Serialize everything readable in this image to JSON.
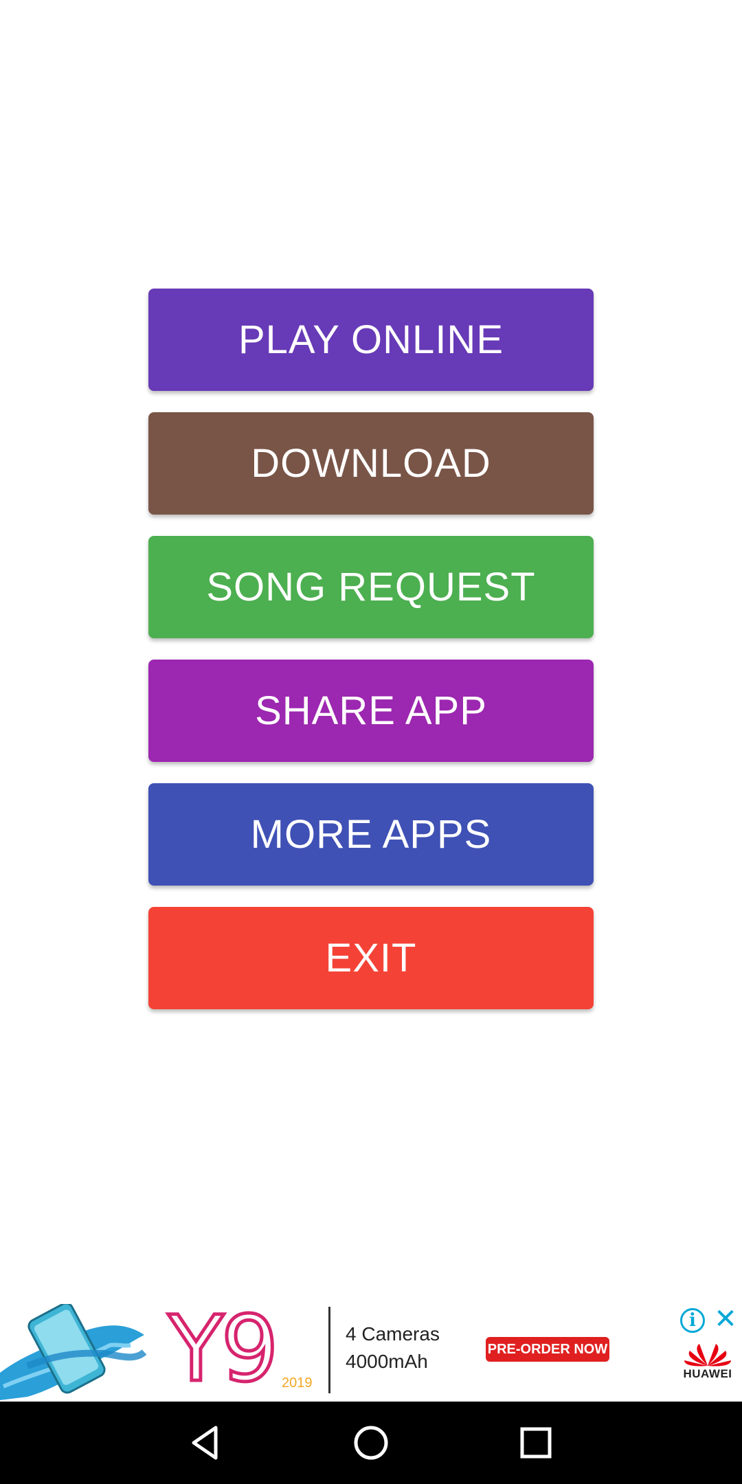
{
  "menu": {
    "buttons": [
      {
        "id": "play_online",
        "label": "PLAY ONLINE",
        "color": "#673ab7"
      },
      {
        "id": "download",
        "label": "DOWNLOAD",
        "color": "#795548"
      },
      {
        "id": "song_request",
        "label": "SONG REQUEST",
        "color": "#4caf50"
      },
      {
        "id": "share_app",
        "label": "SHARE APP",
        "color": "#9c27b0"
      },
      {
        "id": "more_apps",
        "label": "MORE APPS",
        "color": "#3f51b5"
      },
      {
        "id": "exit",
        "label": "EXIT",
        "color": "#f44336"
      }
    ]
  },
  "ad": {
    "product": "Y9",
    "year": "2019",
    "spec_line1": "4 Cameras",
    "spec_line2": "4000mAh",
    "cta": "PRE-ORDER NOW",
    "brand": "HUAWEI",
    "info_icon": "info-icon",
    "close_icon": "close-icon",
    "accent": "#00a8d6"
  },
  "nav_bar": {
    "back_icon": "back-triangle-icon",
    "home_icon": "home-circle-icon",
    "recents_icon": "recents-square-icon"
  }
}
